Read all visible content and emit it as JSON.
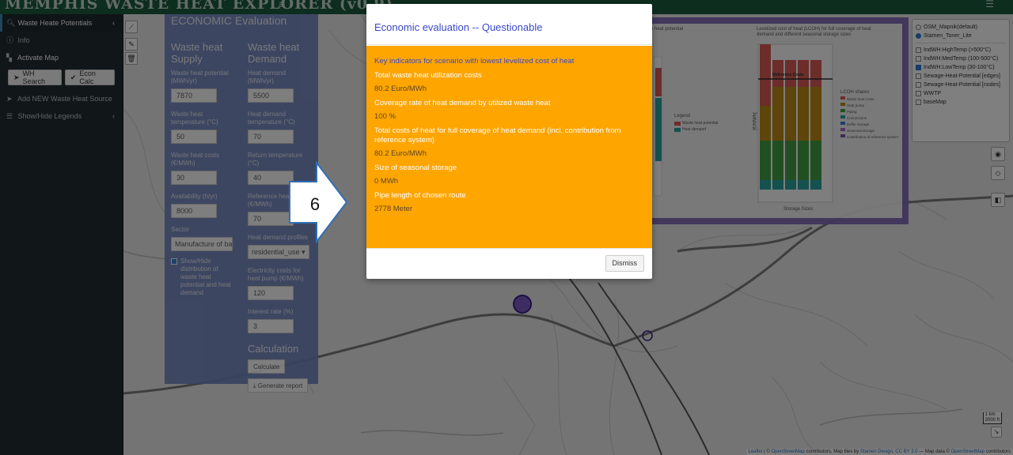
{
  "header": {
    "brand": "MEMPHIS WASTE HEAT EXPLORER (v0.9)",
    "menu_icon": "hamburger-icon",
    "right_icon": "menu-bars-icon"
  },
  "sidebar": {
    "items": [
      {
        "label": "Waste Heate Potentials",
        "icon": "search-icon"
      },
      {
        "label": "Info",
        "icon": "info-icon"
      },
      {
        "label": "Activate Map",
        "icon": "map-icon"
      },
      {
        "label": "Add NEW Waste Heat Source",
        "icon": "paper-plane-icon"
      },
      {
        "label": "Show/Hide Legends",
        "icon": "list-icon"
      }
    ],
    "buttons": [
      {
        "label": "WH Search",
        "icon": "paper-plane-icon"
      },
      {
        "label": "Econ Calc",
        "icon": "check-icon"
      }
    ]
  },
  "econ_panel": {
    "title": "ECONOMIC Evaluation",
    "supply": {
      "heading": "Waste heat Supply",
      "fields": [
        {
          "label": "Waste heat potential (MWh/yr)",
          "value": "7870"
        },
        {
          "label": "Waste heat temperature (°C)",
          "value": "50"
        },
        {
          "label": "Waste heat costs (€/MWh)",
          "value": "30"
        },
        {
          "label": "Availability (h/yr)",
          "value": "8000"
        },
        {
          "label": "Sector",
          "value": "Manufacture of bas"
        }
      ],
      "checkbox_label": "Show/Hide distribution of waste heat potential and heat demand"
    },
    "demand": {
      "heading": "Waste heat Demand",
      "fields": [
        {
          "label": "Heat demand (MWh/yr)",
          "value": "5500"
        },
        {
          "label": "Heat demand temperature (°C)",
          "value": "70"
        },
        {
          "label": "Return temperature (°C)",
          "value": "40"
        },
        {
          "label": "Reference heat (€/MWh)",
          "value": "70"
        },
        {
          "label": "Heat demand profiles",
          "value": "residential_use"
        },
        {
          "label": "Electricity costs for heat pump (€/MWh)",
          "value": "120"
        },
        {
          "label": "Interest rate (%)",
          "value": "3"
        }
      ]
    },
    "calculation": {
      "heading": "Calculation",
      "calculate_label": "Calculate",
      "report_label": "Generate report"
    }
  },
  "charts": {
    "left_title": "e heat potential",
    "right_title": "Levelized cost of heat (LCOH) for full coverage of heat demand and different seasonal storage sizes",
    "left_legend_title": "Legend",
    "left_legend": [
      "Waste heat potential",
      "Heat demand"
    ],
    "right_legend_title": "LCOH shares",
    "right_legend": [
      "Waste heat costs",
      "Heat pump",
      "Piping",
      "Connections",
      "Buffer storage",
      "Seasonal storage",
      "Contribution of reference system"
    ],
    "reference_label": "Reference Costs",
    "x_label": "Storage Sizes",
    "y_label": "[€/MWh]",
    "series_colors": [
      "#d9534f",
      "#b8860b",
      "#3c9a3c",
      "#20a09a",
      "#2b7bd6",
      "#b05cc9"
    ]
  },
  "layers": {
    "base": [
      {
        "label": "OSM_Mapnik(default)",
        "checked": false
      },
      {
        "label": "Stamen_Toner_Lite",
        "checked": true
      }
    ],
    "overlays": [
      {
        "label": "IndWH:HighTemp (>500°C)",
        "checked": false
      },
      {
        "label": "IndWH:MedTemp (100-500°C)",
        "checked": false
      },
      {
        "label": "IndWH:LowTemp (30-100°C)",
        "checked": true
      },
      {
        "label": "Sewage-Heat-Potential [edges]",
        "checked": false
      },
      {
        "label": "Sewage-Heat-Potential [nodes]",
        "checked": false
      },
      {
        "label": "WWTP",
        "checked": false
      },
      {
        "label": "baseMap",
        "checked": false
      }
    ]
  },
  "map": {
    "scale_km": "1 km",
    "scale_ft": "3000 ft",
    "attribution": {
      "leaflet": "Leaflet",
      "sep1": " | © ",
      "osm1": "OpenStreetMap",
      "mid": " contributors, Map tiles by ",
      "stamen": "Stamen Design",
      "comma": ", ",
      "cc": "CC BY 3.0",
      "mapdata": " — Map data © ",
      "osm2": "OpenStreetMap",
      "tail": " contributors"
    }
  },
  "annotation": {
    "number": "6"
  },
  "modal": {
    "title": "Economic evaluation -- Questionable",
    "heading": "Key indicators for scenario with lowest levelized cost of heat",
    "items": [
      {
        "label": "Total waste heat utilization costs",
        "value": "80.2 Euro/MWh"
      },
      {
        "label": "Coverage rate of heat demand by utilized waste heat",
        "value": "100 %"
      },
      {
        "label": "Total costs of heat for full coverage of heat demand (incl. contribution from reference system)",
        "value": "80.2 Euro/MWh"
      },
      {
        "label": "Size of seasonal storage",
        "value": "0 MWh"
      },
      {
        "label": "Pipe length of chosen route",
        "value": "2778 Meter"
      }
    ],
    "dismiss_label": "Dismiss"
  }
}
